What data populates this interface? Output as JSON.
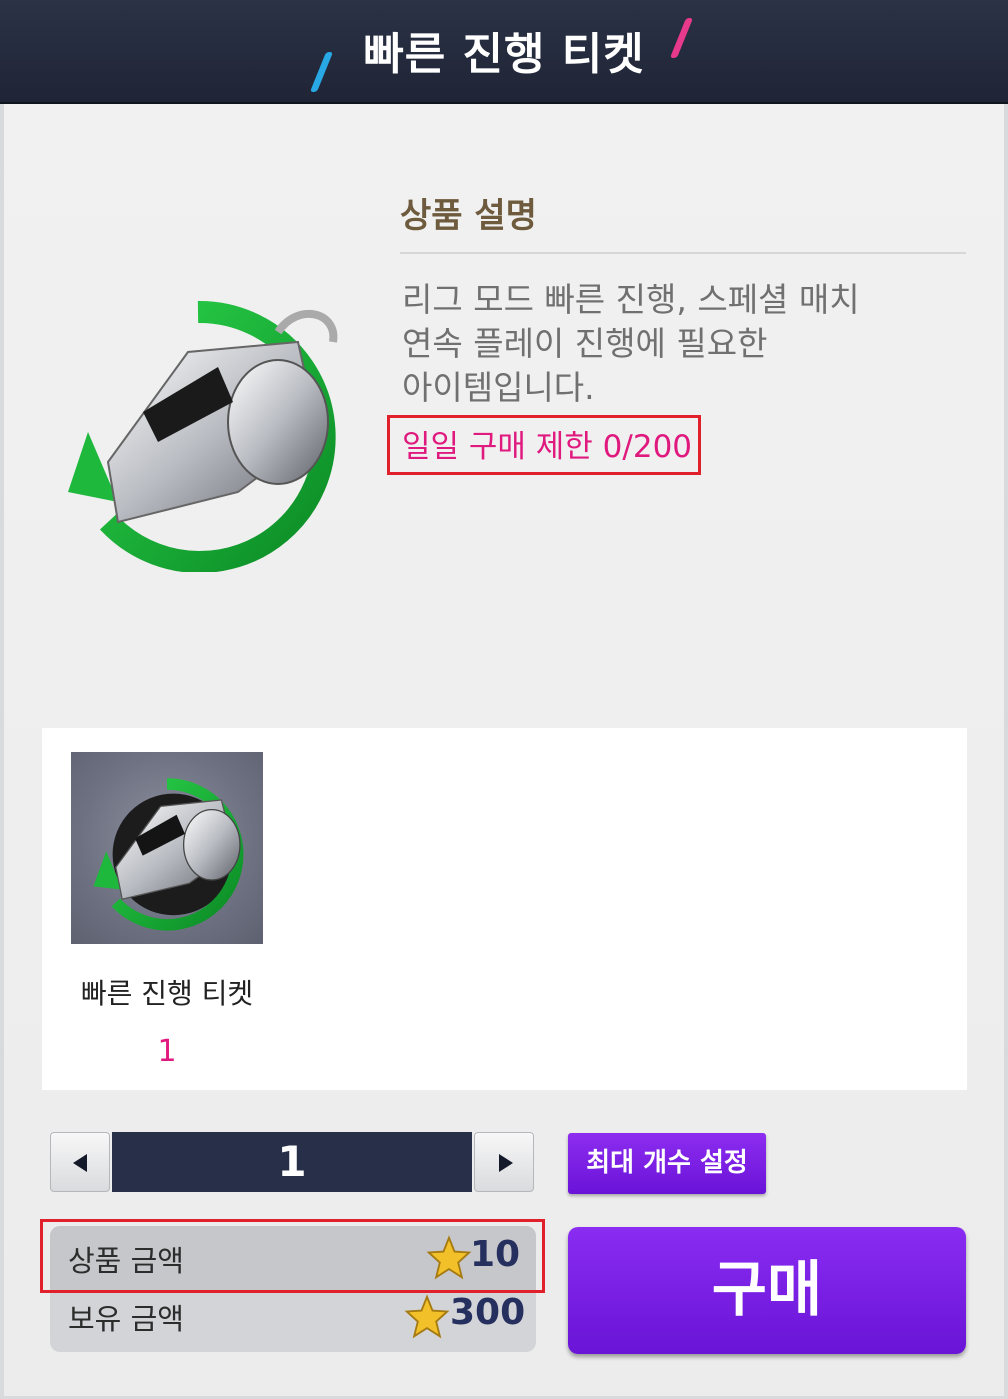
{
  "header": {
    "title": "빠른 진행 티켓"
  },
  "description": {
    "heading": "상품 설명",
    "lines": [
      "리그 모드 빠른 진행, 스페셜 매치",
      "연속 플레이 진행에 필요한",
      "아이템입니다."
    ],
    "daily_limit": "일일 구매 제한 0/200"
  },
  "reward": {
    "name": "빠른 진행 티켓",
    "count": "1"
  },
  "quantity": {
    "value": "1",
    "max_button": "최대 개수 설정"
  },
  "price": {
    "item_label": "상품 금액",
    "item_value": "10",
    "owned_label": "보유 금액",
    "owned_value": "300"
  },
  "buy_button": "구매",
  "icons": [
    "whistle-icon",
    "star-icon",
    "left-arrow-icon",
    "right-arrow-icon"
  ],
  "colors": {
    "accent": "#7a1fe6",
    "highlight": "#e0197f",
    "header": "#222a3d"
  }
}
